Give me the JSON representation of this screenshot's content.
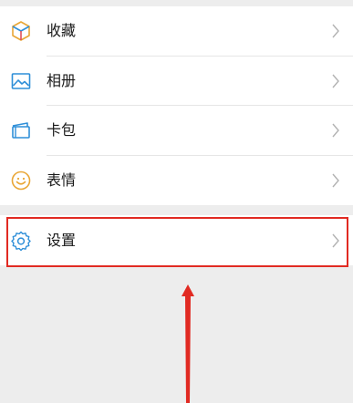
{
  "menu": {
    "items": [
      {
        "label": "收藏",
        "icon": "favorites-cube-icon"
      },
      {
        "label": "相册",
        "icon": "album-picture-icon"
      },
      {
        "label": "卡包",
        "icon": "card-wallet-icon"
      },
      {
        "label": "表情",
        "icon": "sticker-smiley-icon"
      }
    ],
    "settings": {
      "label": "设置",
      "icon": "gear-icon"
    }
  },
  "colors": {
    "background": "#ededed",
    "highlight": "#e12a22",
    "icon_blue": "#2f8fd8",
    "icon_gold": "#e9a635"
  }
}
